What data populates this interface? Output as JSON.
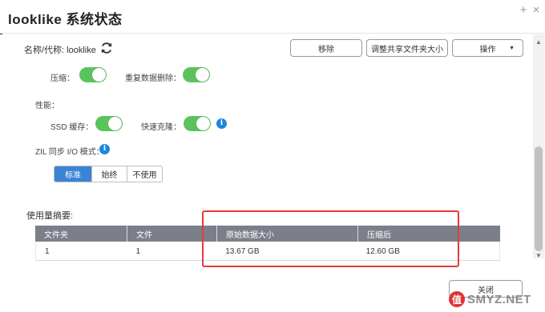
{
  "window": {
    "title": "looklike  系统状态",
    "plus_glyph": "+",
    "close_glyph": "×"
  },
  "header": {
    "name_label": "名称/代称: looklike",
    "remove_label": "移除",
    "resize_label": "调整共享文件夹大小",
    "ops_label": "操作"
  },
  "settings": {
    "compression_label": "压缩：",
    "compression_on": true,
    "dedup_label": "重复数据删除：",
    "dedup_on": true,
    "performance_label": "性能：",
    "ssd_cache_label": "SSD 缓存：",
    "ssd_cache_on": true,
    "fast_clone_label": "快速克隆：",
    "fast_clone_on": true,
    "zil_label": "ZIL 同步 I/O 模式：",
    "zil_options": [
      "标准",
      "始终",
      "不使用"
    ],
    "zil_selected": "标准"
  },
  "summary": {
    "title": "使用量摘要:",
    "columns": [
      "文件夹",
      "文件",
      "原始数据大小",
      "压缩后"
    ],
    "rows": [
      [
        "1",
        "1",
        "13.67 GB",
        "12.60 GB"
      ]
    ]
  },
  "footer": {
    "close_label": "关闭"
  },
  "watermark": {
    "badge": "值",
    "text": "SMYZ.NET"
  },
  "colors": {
    "toggle_on": "#5cc35c",
    "accent": "#3b83d4",
    "info": "#1a88e0",
    "table_header": "#7b7f8a",
    "highlight_box": "#e63a3a"
  },
  "icons": {
    "refresh": "refresh-icon",
    "info": "info-icon",
    "caret": "caret-down-icon"
  }
}
